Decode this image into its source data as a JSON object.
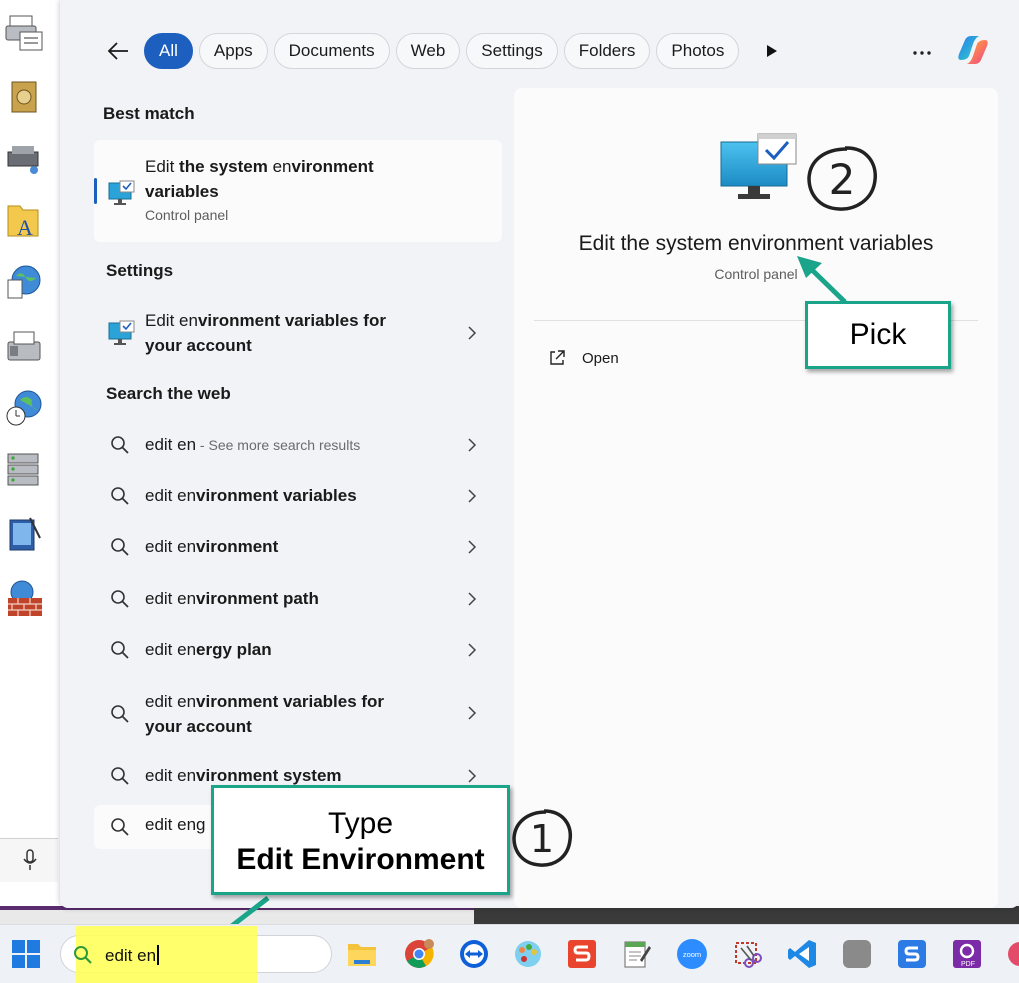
{
  "filters": {
    "chips": [
      "All",
      "Apps",
      "Documents",
      "Web",
      "Settings",
      "Folders",
      "Photos"
    ],
    "active": "All"
  },
  "sections": {
    "best_match": "Best match",
    "settings": "Settings",
    "search_web": "Search the web"
  },
  "best_match": {
    "title_pre": "Edit ",
    "title_bold": "the system",
    "title_mid": " en",
    "title_bold2": "vironment",
    "title_line2": "variables",
    "subtitle": "Control panel"
  },
  "settings_result": {
    "pre": "Edit en",
    "bold": "vironment variables for",
    "line2": "your account"
  },
  "web_results": [
    {
      "pre": "edit en",
      "bold": "",
      "hint": " - See more search results"
    },
    {
      "pre": "edit en",
      "bold": "vironment variables",
      "hint": ""
    },
    {
      "pre": "edit en",
      "bold": "vironment",
      "hint": ""
    },
    {
      "pre": "edit en",
      "bold": "vironment path",
      "hint": ""
    },
    {
      "pre": "edit en",
      "bold": "ergy plan",
      "hint": ""
    },
    {
      "pre": "edit en",
      "bold": "vironment variables for",
      "line2": "your account",
      "hint": ""
    },
    {
      "pre": "edit en",
      "bold": "vironment system",
      "hint": ""
    },
    {
      "pre": "edit eng",
      "bold": "",
      "hint": ""
    }
  ],
  "detail": {
    "title": "Edit the system environment variables",
    "subtitle": "Control panel",
    "action_open": "Open"
  },
  "annotations": {
    "pick": "Pick",
    "type_line1": "Type",
    "type_line2": "Edit Environment",
    "step1": "1",
    "step2": "2",
    "accent": "#1aa58a"
  },
  "taskbar": {
    "search_value": "edit en",
    "apps": [
      "file-explorer-icon",
      "chrome-icon",
      "teamviewer-icon",
      "paint-icon",
      "snagit-icon",
      "notepad-icon",
      "zoom-icon",
      "snipping-tool-icon",
      "vscode-icon",
      "blank-app-icon",
      "sogou-icon",
      "pdf-icon"
    ],
    "zoom_label": "zoom",
    "pdf_label": "PDF"
  }
}
